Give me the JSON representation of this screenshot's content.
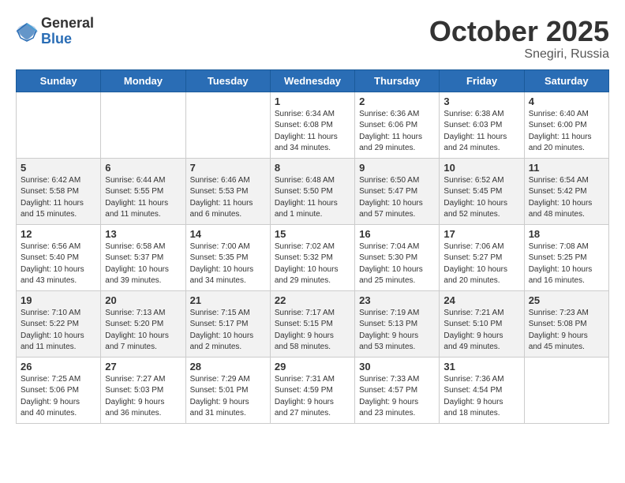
{
  "header": {
    "logo_general": "General",
    "logo_blue": "Blue",
    "month_title": "October 2025",
    "subtitle": "Snegiri, Russia"
  },
  "days": [
    "Sunday",
    "Monday",
    "Tuesday",
    "Wednesday",
    "Thursday",
    "Friday",
    "Saturday"
  ],
  "weeks": [
    [
      {
        "date": "",
        "text": ""
      },
      {
        "date": "",
        "text": ""
      },
      {
        "date": "",
        "text": ""
      },
      {
        "date": "1",
        "text": "Sunrise: 6:34 AM\nSunset: 6:08 PM\nDaylight: 11 hours\nand 34 minutes."
      },
      {
        "date": "2",
        "text": "Sunrise: 6:36 AM\nSunset: 6:06 PM\nDaylight: 11 hours\nand 29 minutes."
      },
      {
        "date": "3",
        "text": "Sunrise: 6:38 AM\nSunset: 6:03 PM\nDaylight: 11 hours\nand 24 minutes."
      },
      {
        "date": "4",
        "text": "Sunrise: 6:40 AM\nSunset: 6:00 PM\nDaylight: 11 hours\nand 20 minutes."
      }
    ],
    [
      {
        "date": "5",
        "text": "Sunrise: 6:42 AM\nSunset: 5:58 PM\nDaylight: 11 hours\nand 15 minutes."
      },
      {
        "date": "6",
        "text": "Sunrise: 6:44 AM\nSunset: 5:55 PM\nDaylight: 11 hours\nand 11 minutes."
      },
      {
        "date": "7",
        "text": "Sunrise: 6:46 AM\nSunset: 5:53 PM\nDaylight: 11 hours\nand 6 minutes."
      },
      {
        "date": "8",
        "text": "Sunrise: 6:48 AM\nSunset: 5:50 PM\nDaylight: 11 hours\nand 1 minute."
      },
      {
        "date": "9",
        "text": "Sunrise: 6:50 AM\nSunset: 5:47 PM\nDaylight: 10 hours\nand 57 minutes."
      },
      {
        "date": "10",
        "text": "Sunrise: 6:52 AM\nSunset: 5:45 PM\nDaylight: 10 hours\nand 52 minutes."
      },
      {
        "date": "11",
        "text": "Sunrise: 6:54 AM\nSunset: 5:42 PM\nDaylight: 10 hours\nand 48 minutes."
      }
    ],
    [
      {
        "date": "12",
        "text": "Sunrise: 6:56 AM\nSunset: 5:40 PM\nDaylight: 10 hours\nand 43 minutes."
      },
      {
        "date": "13",
        "text": "Sunrise: 6:58 AM\nSunset: 5:37 PM\nDaylight: 10 hours\nand 39 minutes."
      },
      {
        "date": "14",
        "text": "Sunrise: 7:00 AM\nSunset: 5:35 PM\nDaylight: 10 hours\nand 34 minutes."
      },
      {
        "date": "15",
        "text": "Sunrise: 7:02 AM\nSunset: 5:32 PM\nDaylight: 10 hours\nand 29 minutes."
      },
      {
        "date": "16",
        "text": "Sunrise: 7:04 AM\nSunset: 5:30 PM\nDaylight: 10 hours\nand 25 minutes."
      },
      {
        "date": "17",
        "text": "Sunrise: 7:06 AM\nSunset: 5:27 PM\nDaylight: 10 hours\nand 20 minutes."
      },
      {
        "date": "18",
        "text": "Sunrise: 7:08 AM\nSunset: 5:25 PM\nDaylight: 10 hours\nand 16 minutes."
      }
    ],
    [
      {
        "date": "19",
        "text": "Sunrise: 7:10 AM\nSunset: 5:22 PM\nDaylight: 10 hours\nand 11 minutes."
      },
      {
        "date": "20",
        "text": "Sunrise: 7:13 AM\nSunset: 5:20 PM\nDaylight: 10 hours\nand 7 minutes."
      },
      {
        "date": "21",
        "text": "Sunrise: 7:15 AM\nSunset: 5:17 PM\nDaylight: 10 hours\nand 2 minutes."
      },
      {
        "date": "22",
        "text": "Sunrise: 7:17 AM\nSunset: 5:15 PM\nDaylight: 9 hours\nand 58 minutes."
      },
      {
        "date": "23",
        "text": "Sunrise: 7:19 AM\nSunset: 5:13 PM\nDaylight: 9 hours\nand 53 minutes."
      },
      {
        "date": "24",
        "text": "Sunrise: 7:21 AM\nSunset: 5:10 PM\nDaylight: 9 hours\nand 49 minutes."
      },
      {
        "date": "25",
        "text": "Sunrise: 7:23 AM\nSunset: 5:08 PM\nDaylight: 9 hours\nand 45 minutes."
      }
    ],
    [
      {
        "date": "26",
        "text": "Sunrise: 7:25 AM\nSunset: 5:06 PM\nDaylight: 9 hours\nand 40 minutes."
      },
      {
        "date": "27",
        "text": "Sunrise: 7:27 AM\nSunset: 5:03 PM\nDaylight: 9 hours\nand 36 minutes."
      },
      {
        "date": "28",
        "text": "Sunrise: 7:29 AM\nSunset: 5:01 PM\nDaylight: 9 hours\nand 31 minutes."
      },
      {
        "date": "29",
        "text": "Sunrise: 7:31 AM\nSunset: 4:59 PM\nDaylight: 9 hours\nand 27 minutes."
      },
      {
        "date": "30",
        "text": "Sunrise: 7:33 AM\nSunset: 4:57 PM\nDaylight: 9 hours\nand 23 minutes."
      },
      {
        "date": "31",
        "text": "Sunrise: 7:36 AM\nSunset: 4:54 PM\nDaylight: 9 hours\nand 18 minutes."
      },
      {
        "date": "",
        "text": ""
      }
    ]
  ]
}
